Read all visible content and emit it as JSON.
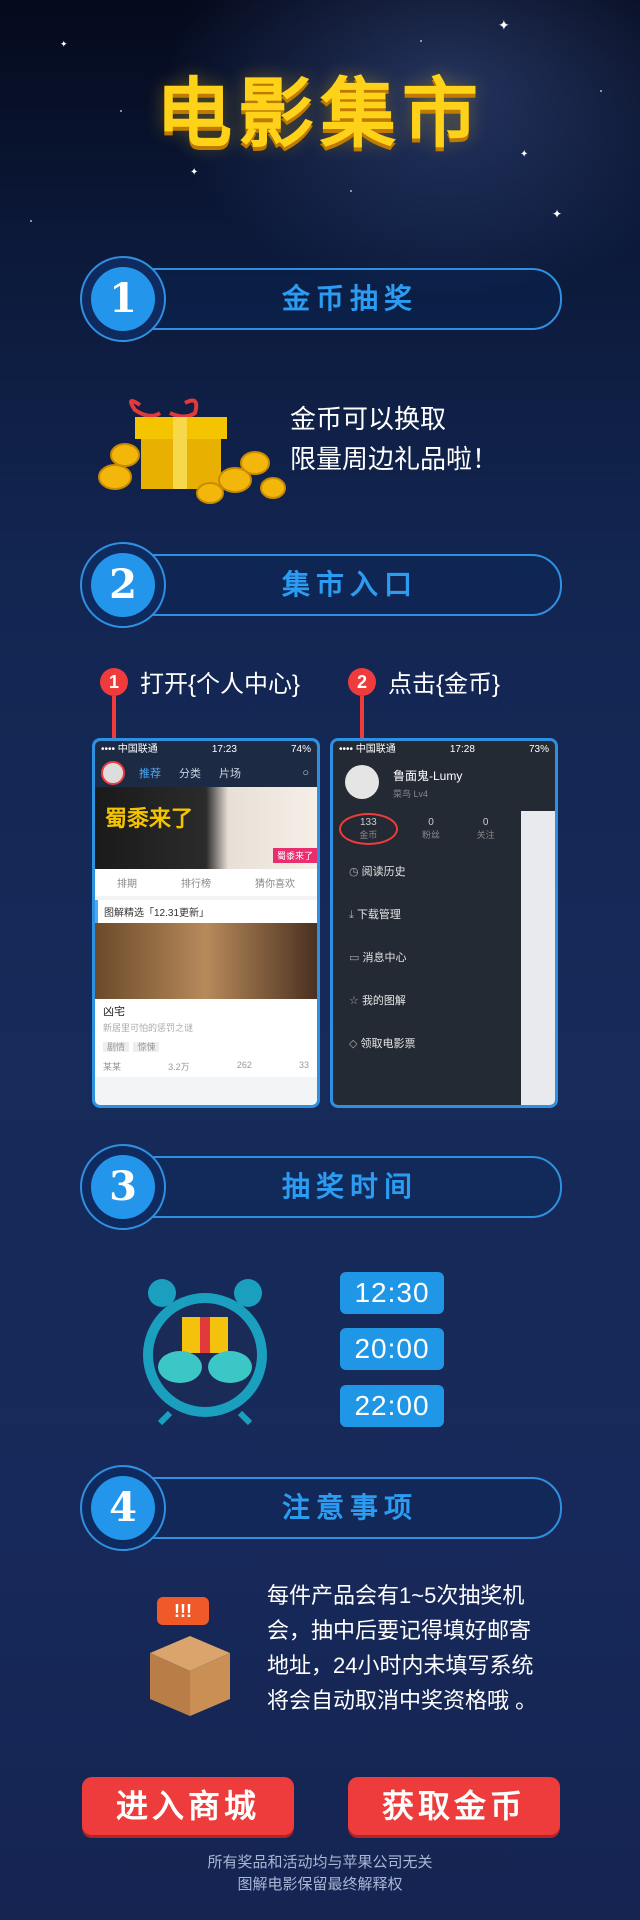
{
  "banner": {
    "title": "电影集市"
  },
  "sections": [
    {
      "number": "1",
      "title": "金币抽奖"
    },
    {
      "number": "2",
      "title": "集市入口"
    },
    {
      "number": "3",
      "title": "抽奖时间"
    },
    {
      "number": "4",
      "title": "注意事项"
    }
  ],
  "lottery": {
    "text": "金币可以换取\n限量周边礼品啦！"
  },
  "entry": {
    "steps": [
      {
        "number": "1",
        "label": "打开{个人中心}"
      },
      {
        "number": "2",
        "label": "点击{金币}"
      }
    ],
    "phone_left": {
      "status": {
        "carrier": "•••• 中国联通",
        "time": "17:23",
        "battery": "74%"
      },
      "tabs": [
        "推荐",
        "分类",
        "片场"
      ],
      "banner_text": "蜀黍来了",
      "banner_tag": "蜀黍来了",
      "quick_links": [
        "排期",
        "排行榜",
        "猜你喜欢"
      ],
      "section_label": "图解精选「12.31更新」",
      "card": {
        "title": "凶宅",
        "subtitle": "新居里可怕的惩罚之谜",
        "tags": [
          "剧情",
          "惊悚"
        ],
        "author": "某某",
        "plays": "3.2万",
        "likes": "262",
        "comments": "33"
      }
    },
    "phone_right": {
      "status": {
        "carrier": "•••• 中国联通",
        "time": "17:28",
        "battery": "73%"
      },
      "profile": {
        "name": "鲁面鬼-Lumy",
        "level": "菜鸟  Lv4"
      },
      "stats": [
        {
          "value": "133",
          "label": "金币"
        },
        {
          "value": "0",
          "label": "粉丝"
        },
        {
          "value": "0",
          "label": "关注"
        }
      ],
      "menu": [
        "阅读历史",
        "下载管理",
        "消息中心",
        "我的图解",
        "领取电影票"
      ]
    }
  },
  "times": [
    "12:30",
    "20:00",
    "22:00"
  ],
  "notes": {
    "badge": "!!!",
    "text": "每件产品会有1~5次抽奖机\n会，抽中后要记得填好邮寄\n地址，24小时内未填写系统\n将会自动取消中奖资格哦 。"
  },
  "buttons": {
    "enter_mall": "进入商城",
    "get_coins": "获取金币"
  },
  "footer": {
    "line1": "所有奖品和活动均与苹果公司无关",
    "line2": "图解电影保留最终解释权"
  },
  "colors": {
    "accent": "#2f8fe0",
    "title_yellow": "#ffd21a",
    "button_red": "#ee3c3c",
    "time_blue": "#1f97e6"
  }
}
